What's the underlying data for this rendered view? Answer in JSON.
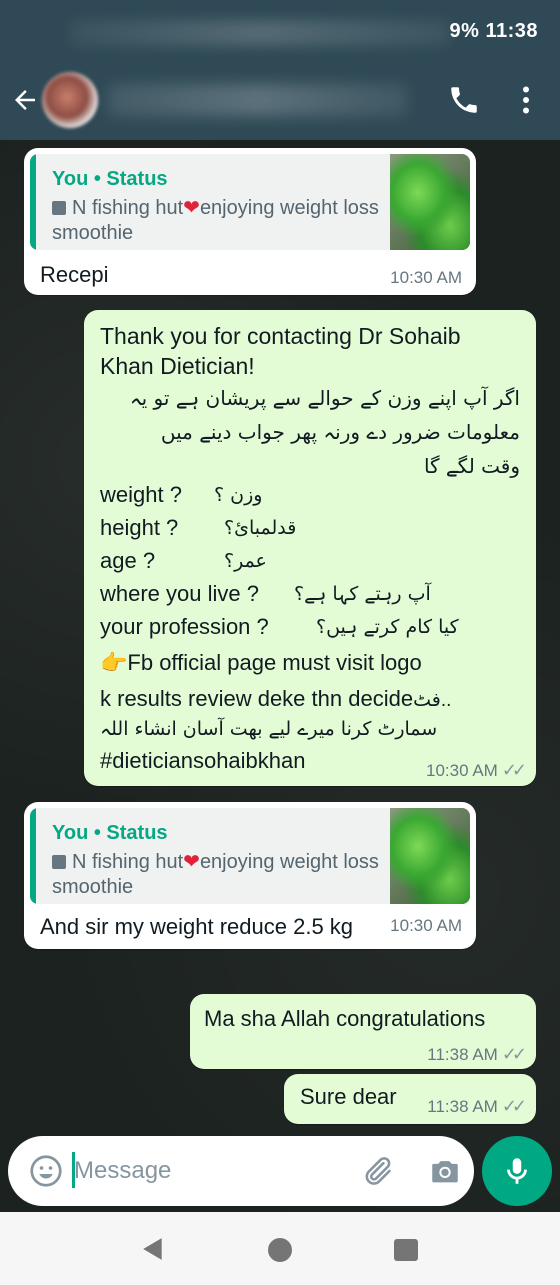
{
  "status_bar": {
    "battery_time": "9% 11:38"
  },
  "header": {
    "contact_name": "",
    "back_icon": "arrow-left-icon",
    "call_icon": "phone-icon",
    "menu_icon": "more-vert-icon"
  },
  "messages": [
    {
      "direction": "incoming",
      "quote": {
        "author": "You • Status",
        "text_before": "N fishing hut",
        "text_after": "enjoying weight loss smoothie"
      },
      "text": "Recepi",
      "time": "10:30 AM"
    },
    {
      "direction": "outgoing",
      "lines_en_intro": [
        "Thank you for contacting Dr Sohaib",
        "Khan Dietician!"
      ],
      "lines_ur_intro": [
        "اگر آپ اپنے وزن کے حوالے سے پریشان ہے تو یہ",
        "معلومات ضرور دے ورنہ پھر جواب دینے میں",
        "وقت لگے گا"
      ],
      "questions": [
        {
          "en": "weight ?",
          "ur": "وزن ؟"
        },
        {
          "en": "height ?",
          "ur": "قدلمبائ؟"
        },
        {
          "en": "age  ?",
          "ur": "عمر؟"
        },
        {
          "en": "where you live ?",
          "ur": "آپ رہتے کہا ہے؟"
        },
        {
          "en": "your profession ?",
          "ur": "کیا کام کرتے ہیں؟"
        }
      ],
      "fb_line": "Fb official page must visit logo",
      "review_line_en": "k results review deke thn decide",
      "review_line_ur": "فٹ..",
      "ur_outro": "سمارٹ کرنا میرے لیے بھت آسان انشاء اللہ",
      "hashtag": "#dieticiansohaibkhan",
      "time": "10:30 AM"
    },
    {
      "direction": "incoming",
      "quote": {
        "author": "You • Status",
        "text_before": "N fishing hut",
        "text_after": "enjoying weight loss smoothie"
      },
      "text": "And sir my weight reduce 2.5 kg",
      "time": "10:30 AM"
    },
    {
      "direction": "outgoing",
      "text": "Ma sha Allah congratulations",
      "time": "11:38 AM"
    },
    {
      "direction": "outgoing",
      "text": "Sure dear",
      "time": "11:38 AM"
    }
  ],
  "composer": {
    "placeholder": "Message",
    "value": ""
  },
  "colors": {
    "header": "#2f4a56",
    "accent": "#00a884",
    "outgoing": "#e4fcd6",
    "incoming": "#ffffff"
  }
}
